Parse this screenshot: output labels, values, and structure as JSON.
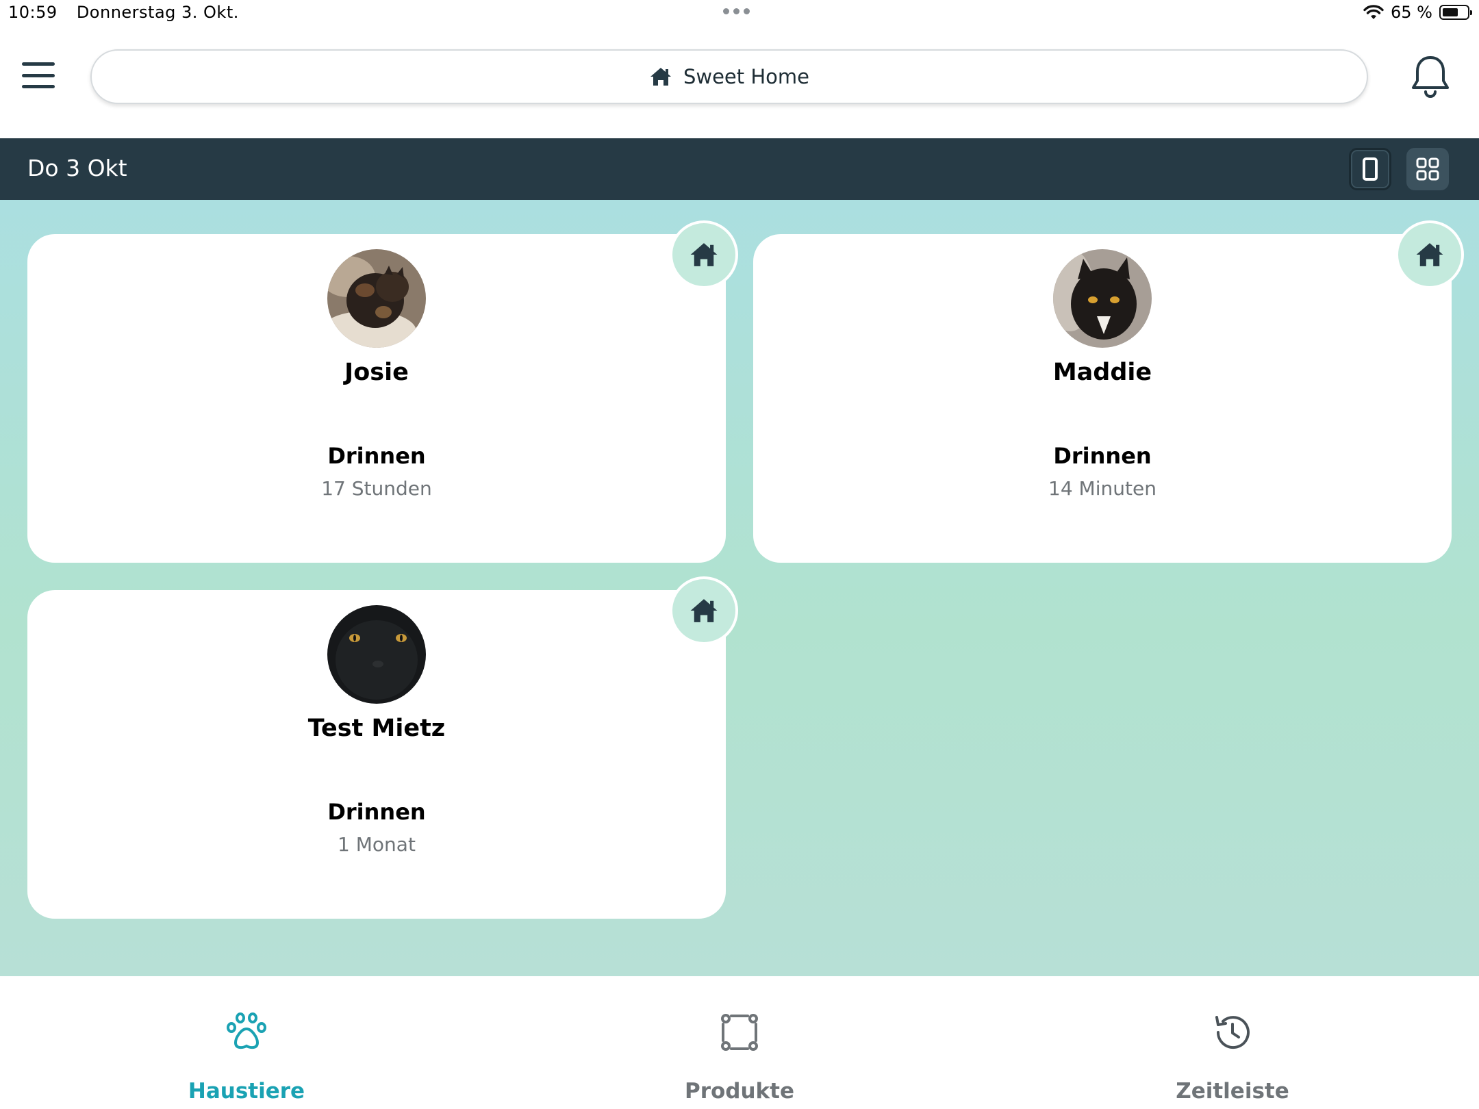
{
  "status_bar": {
    "time": "10:59",
    "date": "Donnerstag 3. Okt.",
    "battery": "65 %",
    "battery_level": 0.65
  },
  "header": {
    "home_name": "Sweet Home"
  },
  "date_bar": {
    "date": "Do 3 Okt"
  },
  "pets": [
    {
      "name": "Josie",
      "status": "Drinnen",
      "since": "17 Stunden"
    },
    {
      "name": "Maddie",
      "status": "Drinnen",
      "since": "14 Minuten"
    },
    {
      "name": "Test Mietz",
      "status": "Drinnen",
      "since": "1 Monat"
    }
  ],
  "nav": {
    "tabs": [
      {
        "label": "Haustiere",
        "icon": "paw-icon",
        "active": true
      },
      {
        "label": "Produkte",
        "icon": "devices-icon",
        "active": false
      },
      {
        "label": "Zeitleiste",
        "icon": "history-icon",
        "active": false
      }
    ]
  },
  "colors": {
    "accent": "#1aa2b3",
    "dark": "#263a45",
    "inactive": "#6f7478"
  }
}
